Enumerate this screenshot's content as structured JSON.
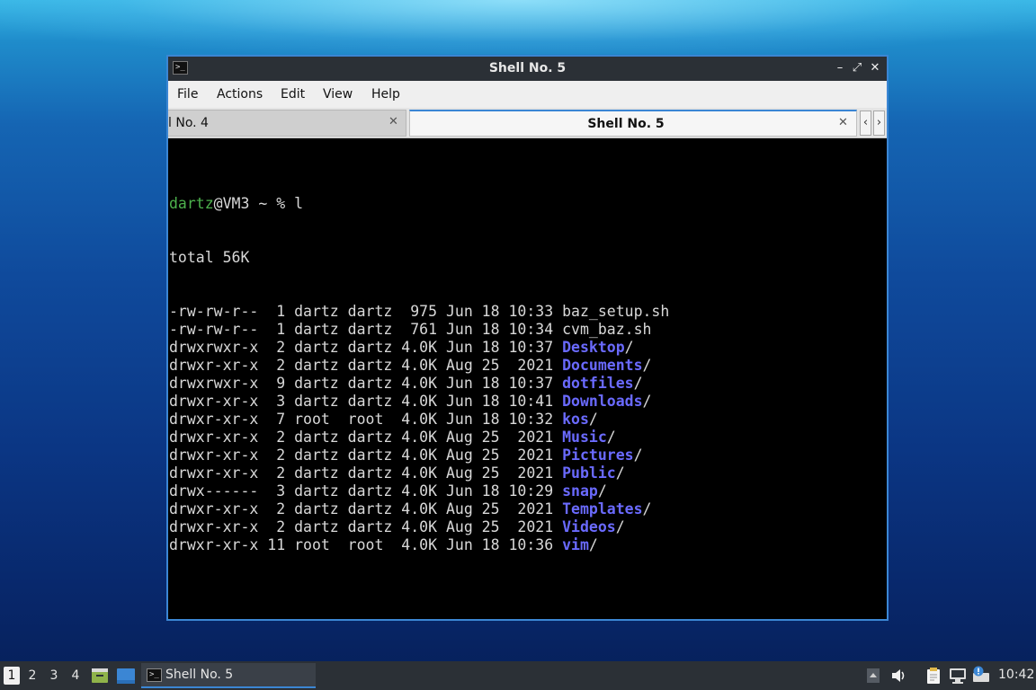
{
  "window": {
    "title": "Shell No. 5",
    "icon": "terminal-icon",
    "controls": {
      "minimize": "–",
      "maximize": "⤢",
      "close": "✕"
    }
  },
  "menubar": {
    "items": [
      "File",
      "Actions",
      "Edit",
      "View",
      "Help"
    ]
  },
  "tabs": [
    {
      "label": "l No. 4",
      "close": "✕",
      "active": false
    },
    {
      "label": "Shell No. 5",
      "close": "✕",
      "active": true
    }
  ],
  "tab_scroll": {
    "left": "‹",
    "right": "›"
  },
  "terminal": {
    "prompt_user": "dartz",
    "prompt_rest": "@VM3 ~ % ",
    "command": "l",
    "total": "total 56K",
    "entries": [
      {
        "meta": "-rw-rw-r--  1 dartz dartz  975 Jun 18 10:33 ",
        "name": "baz_setup.sh",
        "suffix": "",
        "dir": false
      },
      {
        "meta": "-rw-rw-r--  1 dartz dartz  761 Jun 18 10:34 ",
        "name": "cvm_baz.sh",
        "suffix": "",
        "dir": false
      },
      {
        "meta": "drwxrwxr-x  2 dartz dartz 4.0K Jun 18 10:37 ",
        "name": "Desktop",
        "suffix": "/",
        "dir": true
      },
      {
        "meta": "drwxr-xr-x  2 dartz dartz 4.0K Aug 25  2021 ",
        "name": "Documents",
        "suffix": "/",
        "dir": true
      },
      {
        "meta": "drwxrwxr-x  9 dartz dartz 4.0K Jun 18 10:37 ",
        "name": "dotfiles",
        "suffix": "/",
        "dir": true
      },
      {
        "meta": "drwxr-xr-x  3 dartz dartz 4.0K Jun 18 10:41 ",
        "name": "Downloads",
        "suffix": "/",
        "dir": true
      },
      {
        "meta": "drwxr-xr-x  7 root  root  4.0K Jun 18 10:32 ",
        "name": "kos",
        "suffix": "/",
        "dir": true
      },
      {
        "meta": "drwxr-xr-x  2 dartz dartz 4.0K Aug 25  2021 ",
        "name": "Music",
        "suffix": "/",
        "dir": true
      },
      {
        "meta": "drwxr-xr-x  2 dartz dartz 4.0K Aug 25  2021 ",
        "name": "Pictures",
        "suffix": "/",
        "dir": true
      },
      {
        "meta": "drwxr-xr-x  2 dartz dartz 4.0K Aug 25  2021 ",
        "name": "Public",
        "suffix": "/",
        "dir": true
      },
      {
        "meta": "drwx------  3 dartz dartz 4.0K Jun 18 10:29 ",
        "name": "snap",
        "suffix": "/",
        "dir": true
      },
      {
        "meta": "drwxr-xr-x  2 dartz dartz 4.0K Aug 25  2021 ",
        "name": "Templates",
        "suffix": "/",
        "dir": true
      },
      {
        "meta": "drwxr-xr-x  2 dartz dartz 4.0K Aug 25  2021 ",
        "name": "Videos",
        "suffix": "/",
        "dir": true
      },
      {
        "meta": "drwxr-xr-x 11 root  root  4.0K Jun 18 10:36 ",
        "name": "vim",
        "suffix": "/",
        "dir": true
      }
    ]
  },
  "taskbar": {
    "workspaces": [
      "1",
      "2",
      "3",
      "4"
    ],
    "active_workspace": "1",
    "task_label": "Shell No. 5",
    "tray_icons": [
      "tray-arrow-icon",
      "volume-icon",
      "clipboard-icon",
      "network-icon",
      "notification-icon"
    ],
    "clock": "10:42"
  },
  "colors": {
    "accent": "#3b86d4",
    "prompt_user": "#4db24d",
    "directory": "#6a6aff",
    "terminal_bg": "#000000",
    "panel_bg": "#2b3036"
  }
}
